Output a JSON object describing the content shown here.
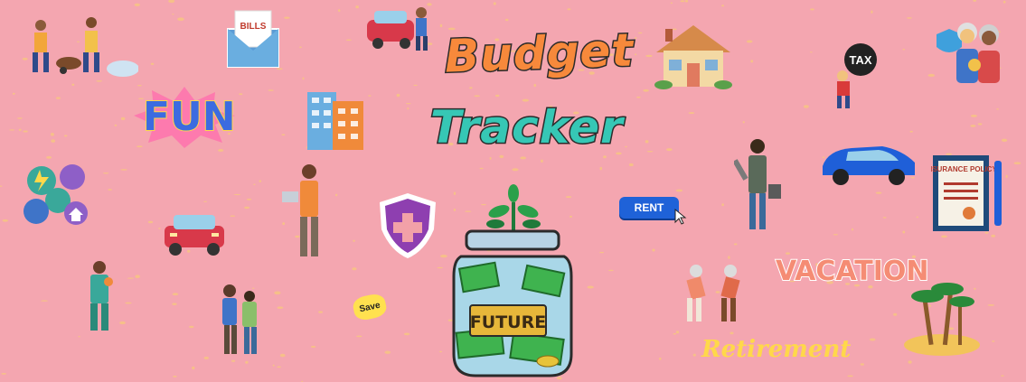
{
  "banner": {
    "title_line1": "Budget",
    "title_line2": "Tracker",
    "fun_sticker": "FUN",
    "vacation_sticker": "VACATION",
    "retirement_text": "Retirement",
    "rent_button": "RENT",
    "save_sticker": "Save",
    "future_jar_label": "FUTURE",
    "bills_envelope": "BILLS",
    "tax_ball": "TAX",
    "insurance_doc": "INSURANCE POLICY"
  },
  "colors": {
    "background": "#f4a6b0",
    "title_orange": "#f7893b",
    "title_teal": "#36c7b5",
    "fun_blue": "#3c6be0",
    "rent_blue": "#1f62d8",
    "speckle_yellow": "#ffd84a"
  },
  "icons": [
    "workers-shoveling-icon",
    "bills-envelope-icon",
    "car-repair-icon",
    "house-icon",
    "tax-ball-icon",
    "elderly-couple-icon",
    "fun-sticker-icon",
    "apartment-building-icon",
    "utilities-icon",
    "red-car-icon",
    "businessman-laptop-icon",
    "health-shield-icon",
    "money-jar-icon",
    "plant-sprout-icon",
    "rent-button-icon",
    "businesswoman-icon",
    "blue-car-icon",
    "insurance-policy-icon",
    "mother-child-icon",
    "family-walking-icon",
    "save-sticker-icon",
    "exercising-seniors-icon",
    "vacation-sticker-icon",
    "island-palm-icon",
    "retirement-text-icon"
  ]
}
